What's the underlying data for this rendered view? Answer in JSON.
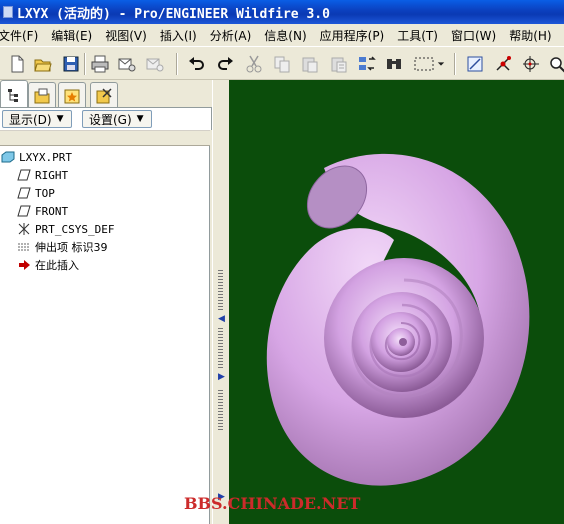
{
  "window": {
    "title": "LXYX (活动的) - Pro/ENGINEER Wildfire 3.0"
  },
  "menu": {
    "items": [
      {
        "label": "文件(F)"
      },
      {
        "label": "编辑(E)"
      },
      {
        "label": "视图(V)"
      },
      {
        "label": "插入(I)"
      },
      {
        "label": "分析(A)"
      },
      {
        "label": "信息(N)"
      },
      {
        "label": "应用程序(P)"
      },
      {
        "label": "工具(T)"
      },
      {
        "label": "窗口(W)"
      },
      {
        "label": "帮助(H)"
      }
    ]
  },
  "toolbar": {
    "icons": [
      "new-file-icon",
      "open-folder-icon",
      "save-icon",
      "print-icon",
      "email-icon",
      "email-disabled-icon",
      "undo-icon",
      "redo-icon",
      "cut-icon",
      "copy-icon",
      "paste-icon",
      "paste-special-icon",
      "regenerate-icon",
      "find-icon",
      "select-box-icon",
      "select-dropdown-icon",
      "sketch-icon",
      "datum-point-icon",
      "coordinate-icon",
      "zoom-icon"
    ]
  },
  "navigator": {
    "display_button": "显示(D)",
    "settings_button": "设置(G)"
  },
  "model_tree": {
    "items": [
      {
        "label": "LXYX.PRT",
        "icon": "part-icon"
      },
      {
        "label": "RIGHT",
        "icon": "datum-plane-icon"
      },
      {
        "label": "TOP",
        "icon": "datum-plane-icon"
      },
      {
        "label": "FRONT",
        "icon": "datum-plane-icon"
      },
      {
        "label": "PRT_CSYS_DEF",
        "icon": "csys-icon"
      },
      {
        "label": "伸出项 标识39",
        "icon": "protrusion-icon"
      },
      {
        "label": "在此插入",
        "icon": "insert-here-arrow-icon"
      }
    ]
  },
  "graphics": {
    "background": "#0b4d0b",
    "model_color": "#d9a8e6"
  },
  "watermark": "BBS.CHINADE.NET"
}
